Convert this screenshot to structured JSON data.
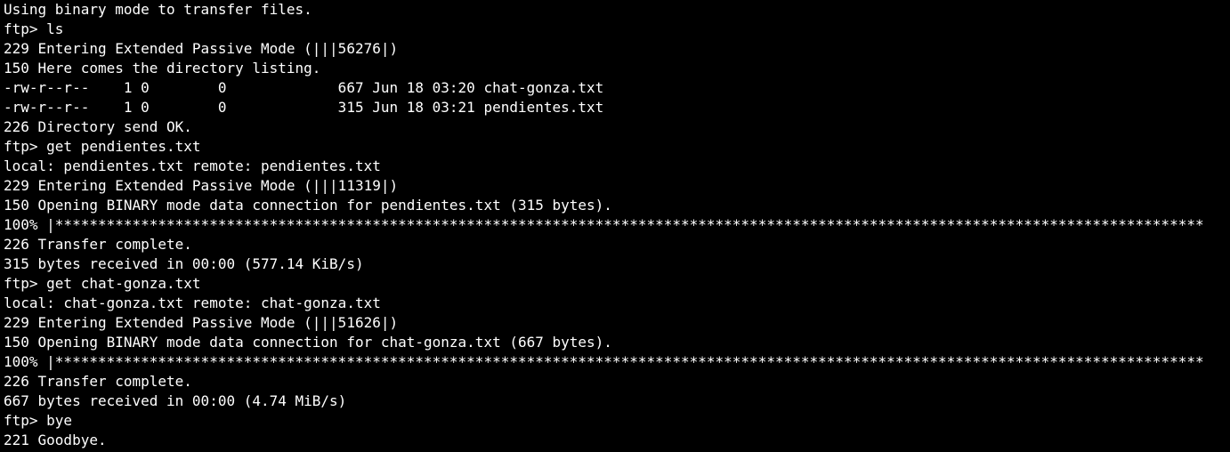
{
  "terminal": {
    "lines": [
      "Using binary mode to transfer files.",
      "ftp> ls",
      "229 Entering Extended Passive Mode (|||56276|)",
      "150 Here comes the directory listing.",
      "-rw-r--r--    1 0        0             667 Jun 18 03:20 chat-gonza.txt",
      "-rw-r--r--    1 0        0             315 Jun 18 03:21 pendientes.txt",
      "226 Directory send OK.",
      "ftp> get pendientes.txt",
      "local: pendientes.txt remote: pendientes.txt",
      "229 Entering Extended Passive Mode (|||11319|)",
      "150 Opening BINARY mode data connection for pendientes.txt (315 bytes).",
      "100% |**************************************************************************************************************************************",
      "226 Transfer complete.",
      "315 bytes received in 00:00 (577.14 KiB/s)",
      "ftp> get chat-gonza.txt",
      "local: chat-gonza.txt remote: chat-gonza.txt",
      "229 Entering Extended Passive Mode (|||51626|)",
      "150 Opening BINARY mode data connection for chat-gonza.txt (667 bytes).",
      "100% |**************************************************************************************************************************************",
      "226 Transfer complete.",
      "667 bytes received in 00:00 (4.74 MiB/s)",
      "ftp> bye",
      "221 Goodbye."
    ]
  },
  "colors": {
    "background": "#000000",
    "foreground": "#ffffff"
  }
}
